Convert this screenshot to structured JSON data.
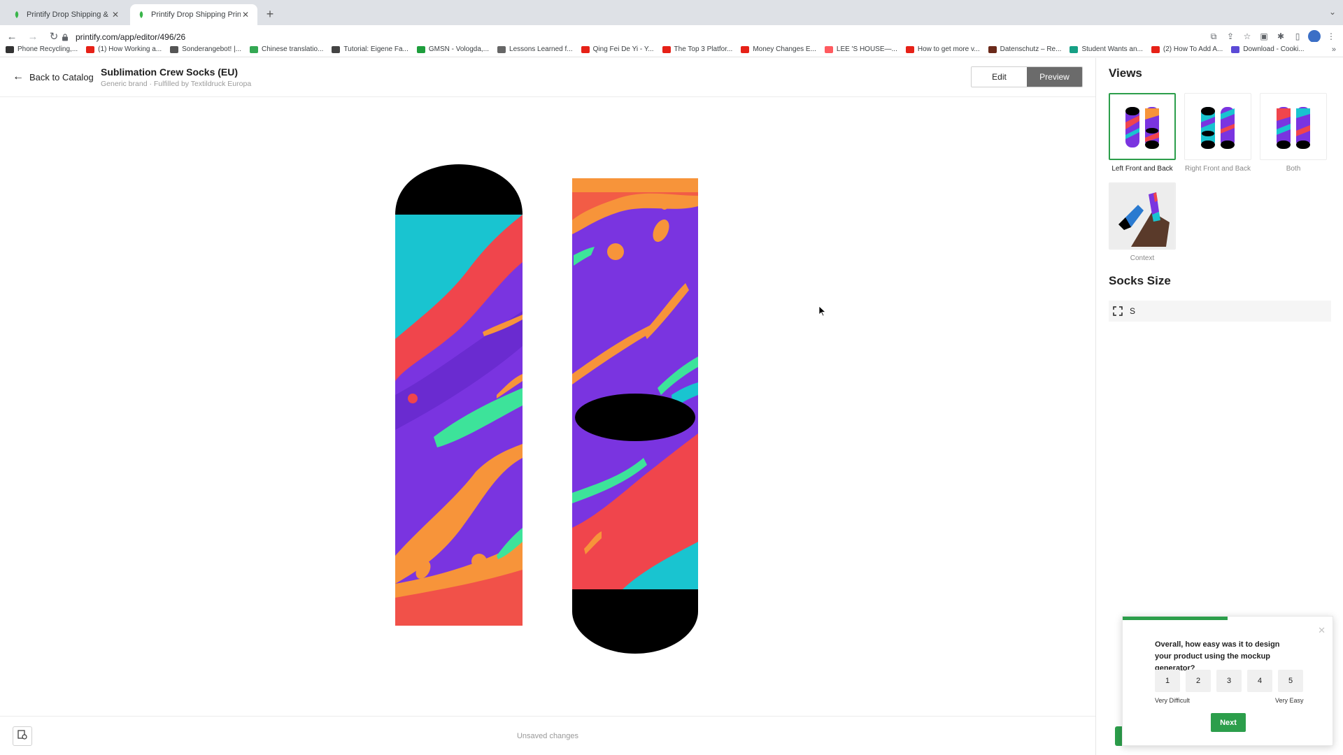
{
  "browser": {
    "tabs": [
      {
        "title": "Printify Drop Shipping & Printi"
      },
      {
        "title": "Printify Drop Shipping Print on"
      }
    ],
    "url": "printify.com/app/editor/496/26",
    "bookmarks": [
      {
        "label": "Phone Recycling,...",
        "icon_color": "#333333"
      },
      {
        "label": "(1) How Working a...",
        "icon_color": "#e62117"
      },
      {
        "label": "Sonderangebot! |...",
        "icon_color": "#555555"
      },
      {
        "label": "Chinese translatio...",
        "icon_color": "#34a853"
      },
      {
        "label": "Tutorial: Eigene Fa...",
        "icon_color": "#444444"
      },
      {
        "label": "GMSN - Vologda,...",
        "icon_color": "#1e9e3c"
      },
      {
        "label": "Lessons Learned f...",
        "icon_color": "#666666"
      },
      {
        "label": "Qing Fei De Yi - Y...",
        "icon_color": "#e62117"
      },
      {
        "label": "The Top 3 Platfor...",
        "icon_color": "#e62117"
      },
      {
        "label": "Money Changes E...",
        "icon_color": "#e62117"
      },
      {
        "label": "LEE 'S HOUSE—...",
        "icon_color": "#ff5a5f"
      },
      {
        "label": "How to get more v...",
        "icon_color": "#e62117"
      },
      {
        "label": "Datenschutz – Re...",
        "icon_color": "#6b2a1a"
      },
      {
        "label": "Student Wants an...",
        "icon_color": "#16a085"
      },
      {
        "label": "(2) How To Add A...",
        "icon_color": "#e62117"
      },
      {
        "label": "Download - Cooki...",
        "icon_color": "#5b4ad6"
      }
    ]
  },
  "header": {
    "back_label": "Back to Catalog",
    "product_title": "Sublimation Crew Socks (EU)",
    "product_subtitle": "Generic brand · Fulfilled by Textildruck Europa",
    "edit_label": "Edit",
    "preview_label": "Preview"
  },
  "panel": {
    "views_title": "Views",
    "views": [
      {
        "label": "Left Front and Back",
        "selected": true
      },
      {
        "label": "Right Front and Back",
        "selected": false
      },
      {
        "label": "Both",
        "selected": false
      },
      {
        "label": "Context",
        "selected": false
      }
    ],
    "size_title": "Socks Size",
    "size_value": "S"
  },
  "footer": {
    "status": "Unsaved changes"
  },
  "survey": {
    "question": "Overall, how easy was it to design your product using the mockup generator?",
    "options": [
      "1",
      "2",
      "3",
      "4",
      "5"
    ],
    "min_label": "Very Difficult",
    "max_label": "Very Easy",
    "next_label": "Next",
    "progress": 0.5
  },
  "colors": {
    "accent_green": "#2c9e4b",
    "sock_purple": "#7a34e0",
    "sock_cyan": "#19c4d0",
    "sock_red": "#f0454c",
    "sock_orange": "#f7943a",
    "sock_green": "#3de39a"
  }
}
